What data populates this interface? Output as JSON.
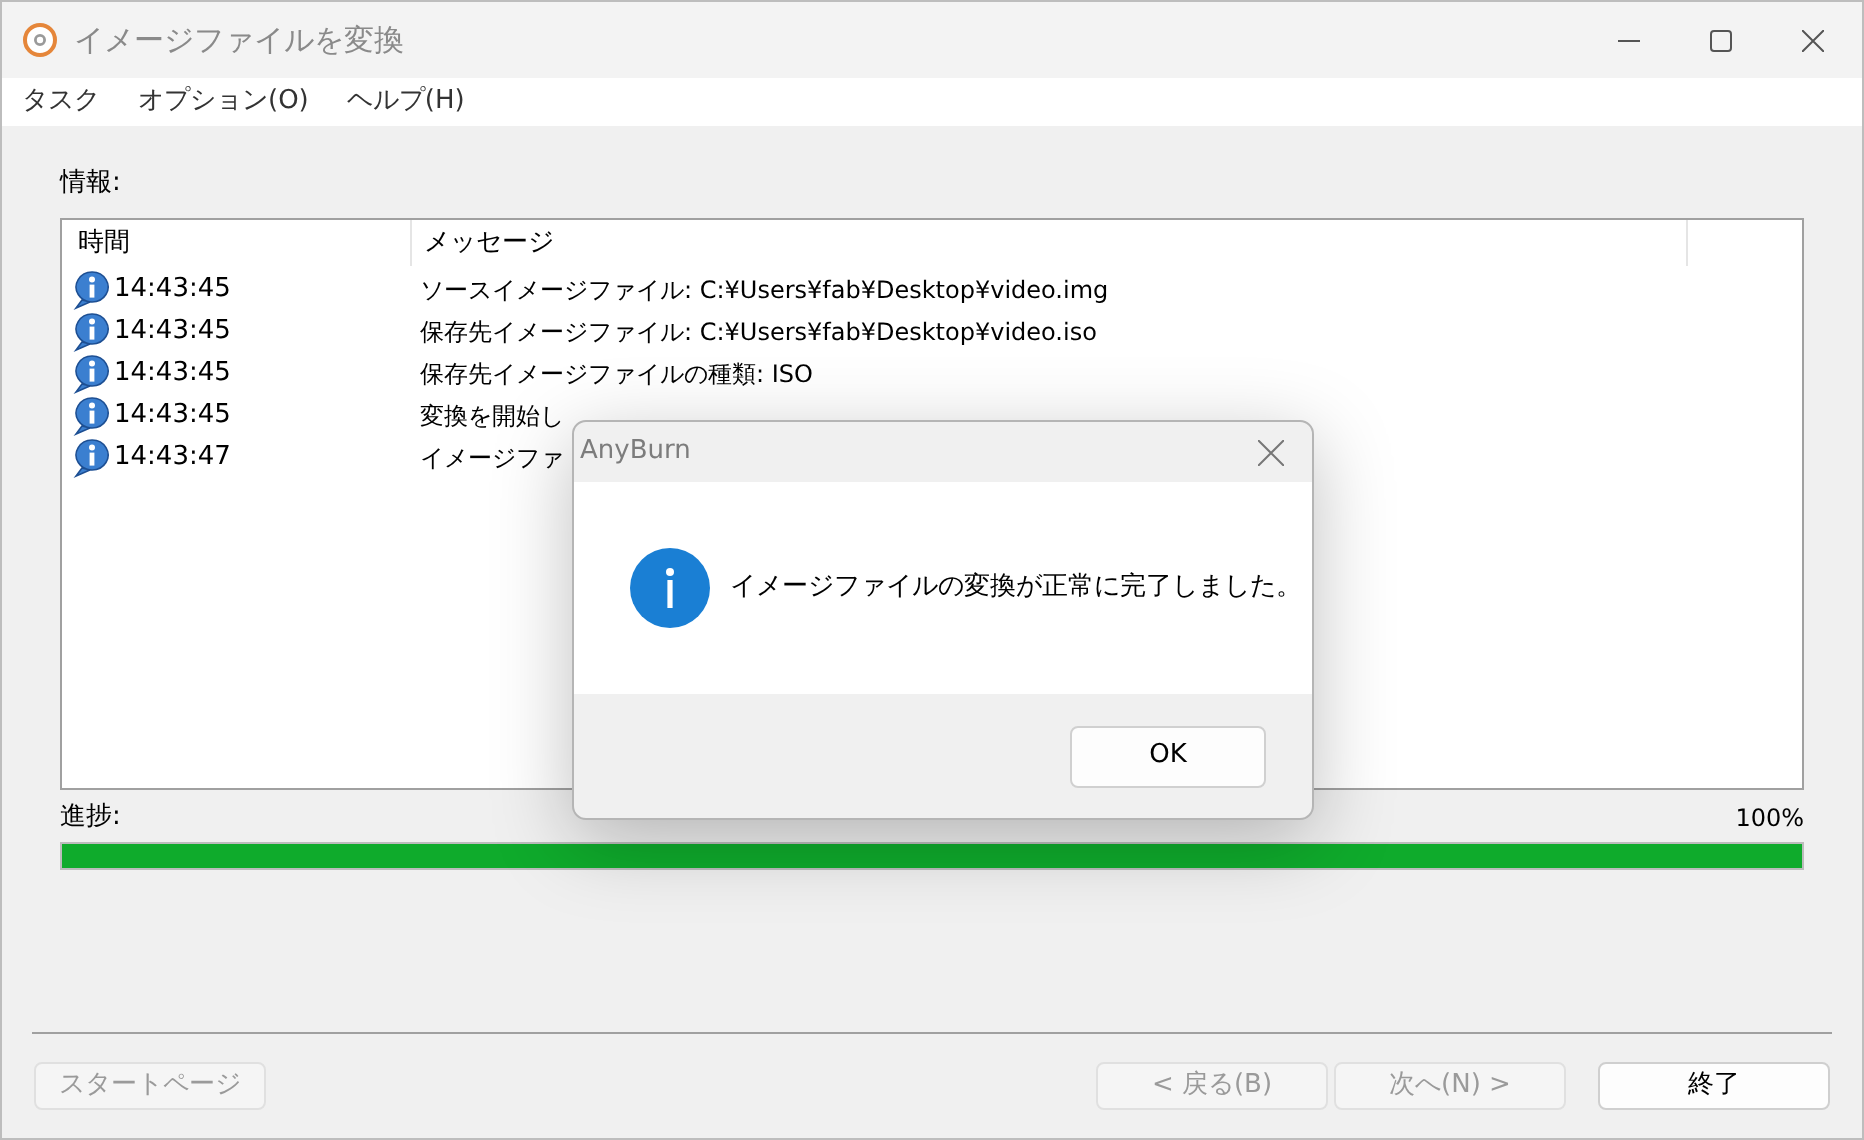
{
  "window": {
    "title": "イメージファイルを変換"
  },
  "menu": [
    {
      "label": "タスク"
    },
    {
      "label": "オプション(O)"
    },
    {
      "label": "ヘルプ(H)"
    }
  ],
  "info_label": "情報:",
  "log": {
    "columns": [
      "時間",
      "メッセージ"
    ],
    "rows": [
      {
        "time": "14:43:45",
        "message": "ソースイメージファイル: C:¥Users¥fab¥Desktop¥video.img"
      },
      {
        "time": "14:43:45",
        "message": "保存先イメージファイル: C:¥Users¥fab¥Desktop¥video.iso"
      },
      {
        "time": "14:43:45",
        "message": "保存先イメージファイルの種類: ISO"
      },
      {
        "time": "14:43:45",
        "message": "変換を開始し"
      },
      {
        "time": "14:43:47",
        "message": "イメージファ"
      }
    ]
  },
  "progress": {
    "label": "進捗:",
    "reading": "100%",
    "level": 1
  },
  "buttons": [
    {
      "label": "スタートページ",
      "disabled": true
    },
    {
      "label": "< 戻る(B)",
      "disabled": true
    },
    {
      "label": "次へ(N) >",
      "disabled": true
    },
    {
      "label": "終了",
      "disabled": false
    }
  ],
  "dialog": {
    "title": "AnyBurn",
    "message": "イメージファイルの変換が正常に完了しました。",
    "button": "OK"
  }
}
